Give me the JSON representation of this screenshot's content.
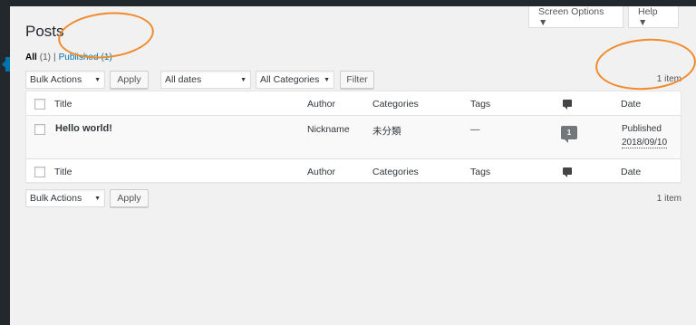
{
  "header": {
    "screen_options": "Screen Options ▼",
    "help": "Help ▼",
    "title": "Posts"
  },
  "filters": {
    "all": "All",
    "all_count": "(1)",
    "separator": "|",
    "published": "Published",
    "published_count": "(1)"
  },
  "tablenav_top": {
    "bulk_actions": "Bulk Actions",
    "apply": "Apply",
    "dates": "All dates",
    "categories": "All Categories",
    "filter": "Filter",
    "count": "1 item"
  },
  "table": {
    "columns": {
      "title": "Title",
      "author": "Author",
      "categories": "Categories",
      "tags": "Tags",
      "date": "Date"
    },
    "rows": [
      {
        "title": "Hello world!",
        "author": "Nickname",
        "category": "未分類",
        "tags": "—",
        "comments": "1",
        "status": "Published",
        "date": "2018/09/10"
      }
    ]
  },
  "tablenav_bottom": {
    "bulk_actions": "Bulk Actions",
    "apply": "Apply",
    "count": "1 item"
  },
  "colors": {
    "link": "#0073aa",
    "admin_bar": "#23282d",
    "annotation": "#f08a2a"
  }
}
